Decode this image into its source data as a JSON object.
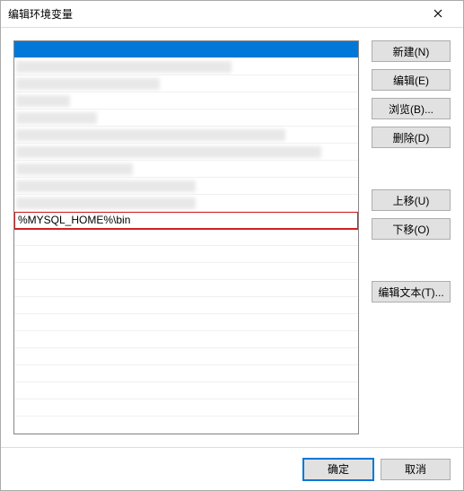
{
  "title": "编辑环境变量",
  "list": {
    "highlighted_value": "%MYSQL_HOME%\\bin"
  },
  "buttons": {
    "new": "新建(N)",
    "edit": "编辑(E)",
    "browse": "浏览(B)...",
    "delete": "删除(D)",
    "move_up": "上移(U)",
    "move_down": "下移(O)",
    "edit_text": "编辑文本(T)..."
  },
  "footer": {
    "ok": "确定",
    "cancel": "取消"
  }
}
